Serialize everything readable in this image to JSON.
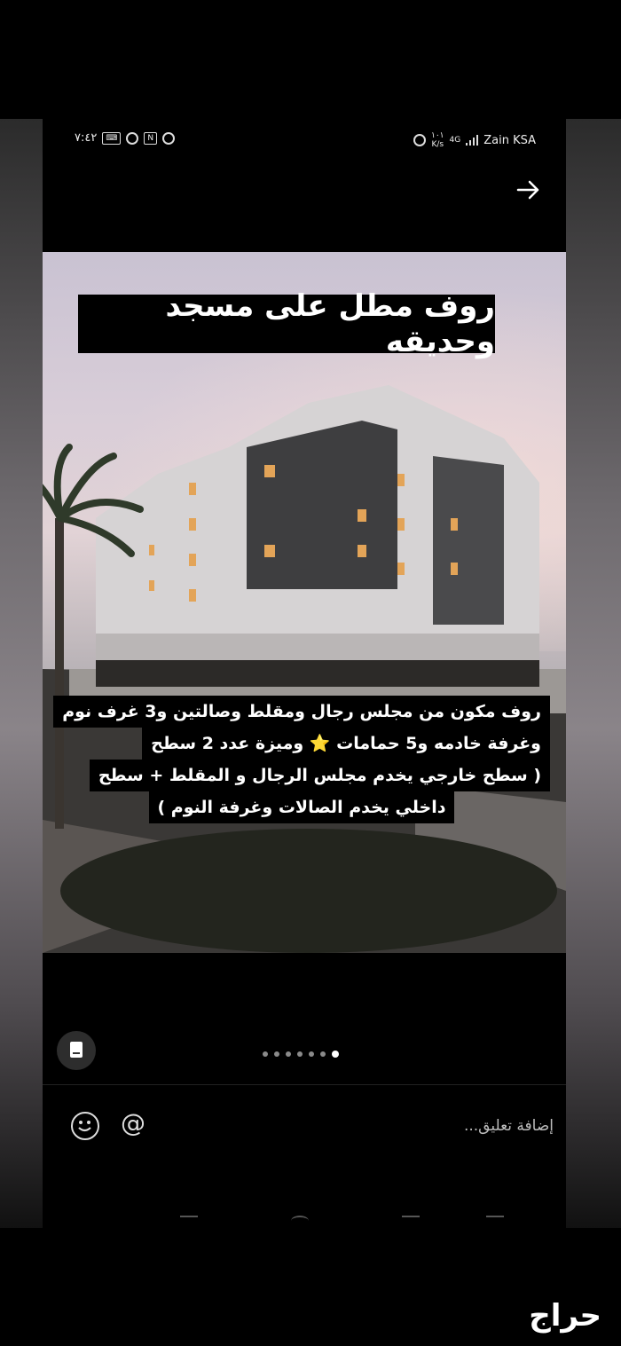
{
  "status_bar": {
    "time": "٧:٤٢",
    "network_speed_value": "١٠١",
    "network_speed_unit": "K/s",
    "network_type": "4G",
    "carrier": "Zain KSA"
  },
  "post": {
    "title": "روف مطل على مسجد وحديقه",
    "description_lines": [
      "روف مكون من مجلس رجال ومقلط وصالتين و3 غرف نوم",
      "وغرفة خادمه و5 حمامات ⭐ وميزة عدد 2 سطح",
      "( سطح خارجي يخدم مجلس الرجال و المقلط + سطح",
      "داخلي يخدم الصالات وغرفة النوم )"
    ]
  },
  "carousel": {
    "total": 7,
    "active_index": 6
  },
  "comment": {
    "placeholder": "إضافة تعليق..."
  },
  "watermark": {
    "text": "حراج"
  },
  "icons": {
    "arrow": "arrow-right-icon",
    "doc": "document-icon",
    "emoji": "smiley-icon",
    "mention": "at-icon"
  }
}
